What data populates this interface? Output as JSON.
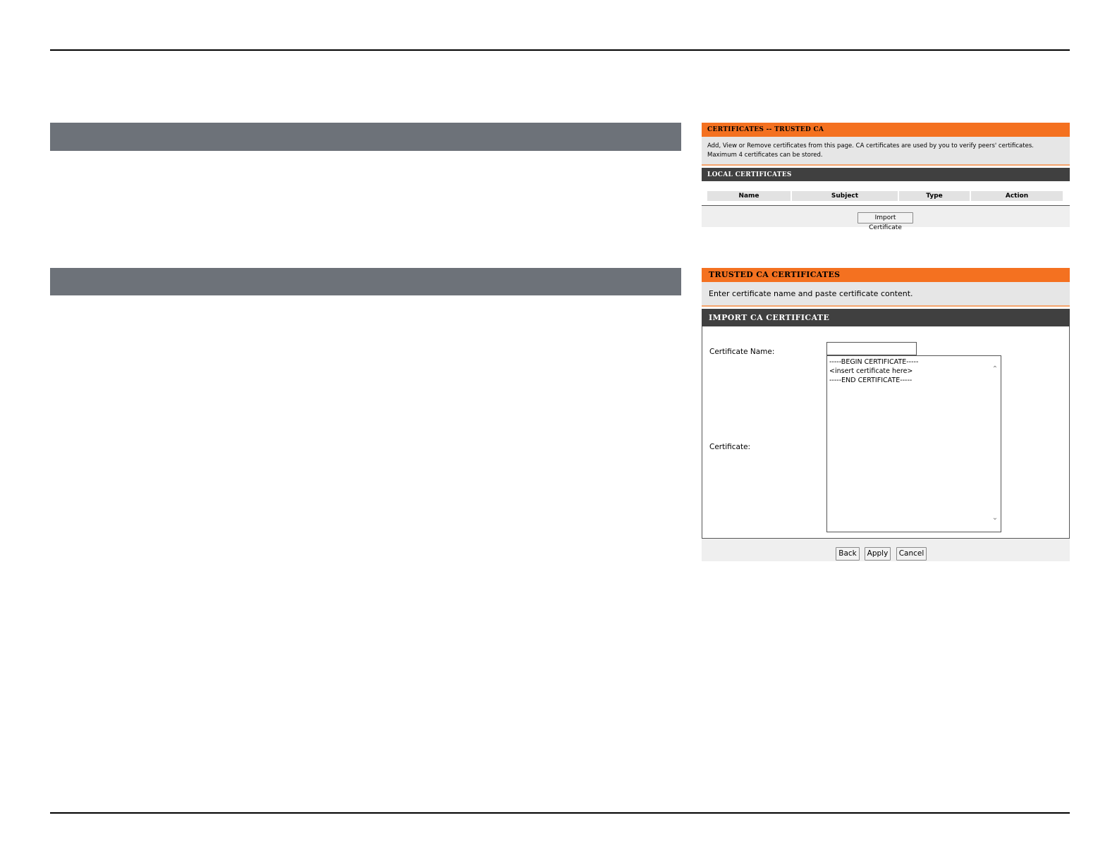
{
  "panel1": {
    "header": "CERTIFICATES -- TRUSTED CA",
    "description_line1": "Add, View or Remove certificates from this page. CA certificates are used by you to verify peers' certificates.",
    "description_line2": "Maximum 4 certificates can be stored.",
    "section_title": "LOCAL CERTIFICATES",
    "table_headers": [
      "Name",
      "Subject",
      "Type",
      "Action"
    ],
    "import_button": "Import Certificate"
  },
  "panel2": {
    "header": "TRUSTED CA CERTIFICATES",
    "description": "Enter certificate name and paste certificate content.",
    "section_title": "IMPORT CA CERTIFICATE",
    "name_label": "Certificate Name:",
    "name_value": "",
    "cert_label": "Certificate:",
    "cert_lines": [
      "-----BEGIN CERTIFICATE-----",
      "<insert certificate here>",
      "-----END CERTIFICATE-----"
    ],
    "buttons": {
      "back": "Back",
      "apply": "Apply",
      "cancel": "Cancel"
    }
  },
  "colors": {
    "orange_header": "#f47120",
    "dark_header": "#404040",
    "gray_bar": "#6d7279",
    "panel_bg": "#e6e6e6"
  }
}
